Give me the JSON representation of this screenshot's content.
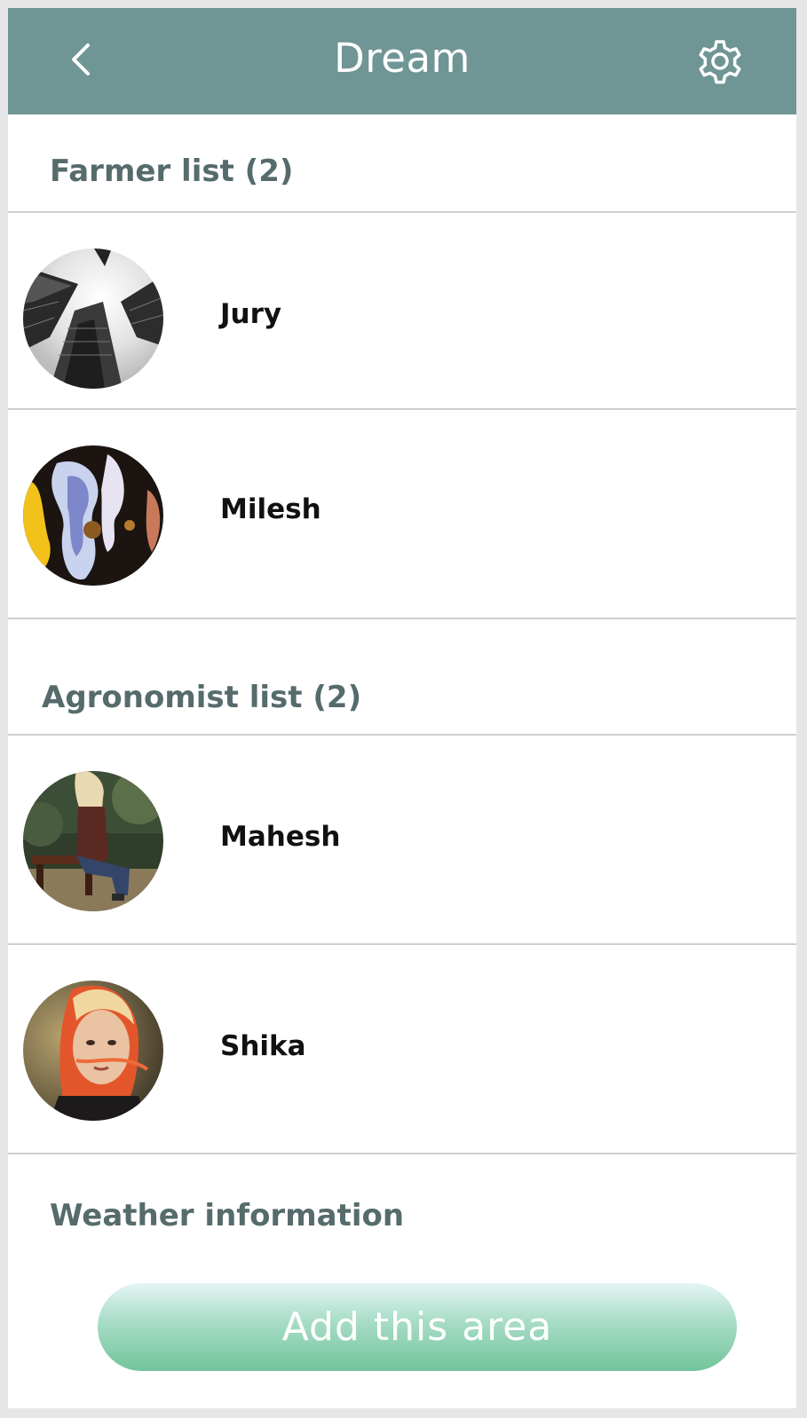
{
  "header": {
    "title": "Dream",
    "background": "#6f9595",
    "back_icon": "chevron-left-icon",
    "settings_icon": "gear-icon"
  },
  "farmer_section": {
    "title": "Farmer list (2)",
    "items": [
      {
        "name": "Jury",
        "avatar": "skyscrapers-photo"
      },
      {
        "name": "Milesh",
        "avatar": "abstract-paint-photo"
      }
    ]
  },
  "agronomist_section": {
    "title": "Agronomist list (2)",
    "items": [
      {
        "name": "Mahesh",
        "avatar": "woman-on-bench-photo"
      },
      {
        "name": "Shika",
        "avatar": "red-hair-portrait-photo"
      }
    ]
  },
  "weather_section": {
    "title": "Weather information"
  },
  "cta": {
    "label": "Add this area",
    "color_top": "#e4f5f4",
    "color_bottom": "#72c49b"
  },
  "colors": {
    "section_title": "#566b6b",
    "name_text": "#111111",
    "divider": "#cfcfcf"
  }
}
